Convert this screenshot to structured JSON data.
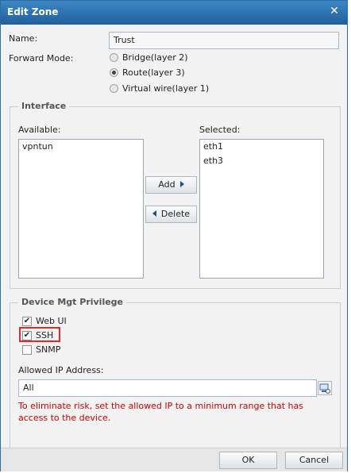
{
  "window": {
    "title": "Edit Zone"
  },
  "form": {
    "name_label": "Name:",
    "name_value": "Trust",
    "forward_mode_label": "Forward Mode:",
    "forward_mode_options": [
      {
        "label": "Bridge(layer 2)",
        "selected": false
      },
      {
        "label": "Route(layer 3)",
        "selected": true
      },
      {
        "label": "Virtual wire(layer 1)",
        "selected": false
      }
    ]
  },
  "interface": {
    "legend": "Interface",
    "available_label": "Available:",
    "available_items": [
      "vpntun"
    ],
    "selected_label": "Selected:",
    "selected_items": [
      "eth1",
      "eth3"
    ],
    "add_label": "Add",
    "delete_label": "Delete"
  },
  "mgt": {
    "legend": "Device Mgt Privilege",
    "options": [
      {
        "label": "Web UI",
        "checked": true
      },
      {
        "label": "SSH",
        "checked": true
      },
      {
        "label": "SNMP",
        "checked": false
      }
    ],
    "allowed_ip_label": "Allowed IP Address:",
    "allowed_ip_value": "All",
    "warning": "To eliminate risk, set the allowed IP to a minimum range that has access to the device."
  },
  "footer": {
    "ok_label": "OK",
    "cancel_label": "Cancel"
  },
  "colors": {
    "title_bar": "#1f5f9c",
    "highlight": "#e02a2a",
    "warning": "#d10000"
  }
}
